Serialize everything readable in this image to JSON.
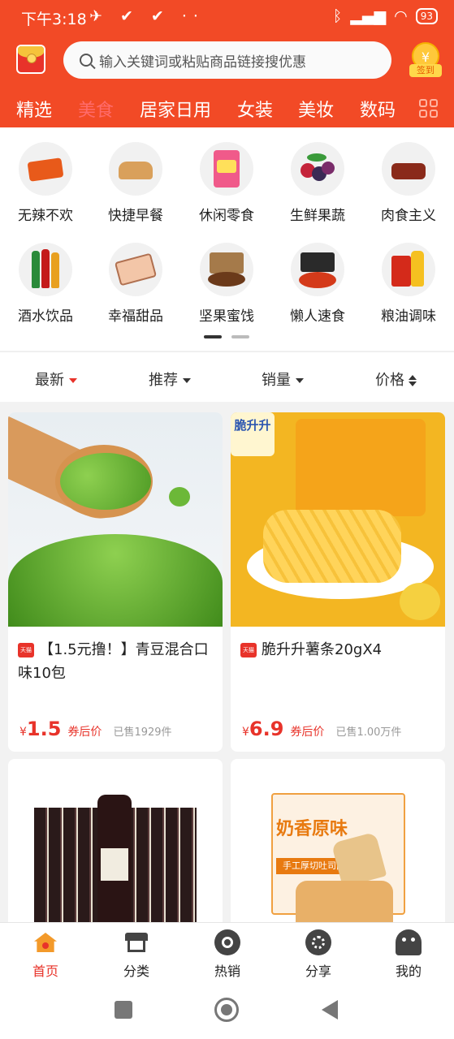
{
  "status_bar": {
    "time": "下午3:18",
    "battery": "93"
  },
  "search": {
    "placeholder": "输入关键词或粘贴商品链接搜优惠"
  },
  "signin": {
    "coin": "¥",
    "label": "签到"
  },
  "categories": [
    "精选",
    "美食",
    "居家日用",
    "女装",
    "美妆",
    "数码"
  ],
  "active_category": "美食",
  "subcategories": [
    "无辣不欢",
    "快捷早餐",
    "休闲零食",
    "生鲜果蔬",
    "肉食主义",
    "酒水饮品",
    "幸福甜品",
    "坚果蜜饯",
    "懒人速食",
    "粮油调味"
  ],
  "sort": {
    "latest": "最新",
    "recommend": "推荐",
    "sales": "销量",
    "price": "价格"
  },
  "products": [
    {
      "title": "【1.5元撸！】青豆混合口味10包",
      "currency": "¥",
      "price": "1.5",
      "after": "券后价",
      "sold": "已售1929件",
      "badge": "天猫"
    },
    {
      "title": "脆升升薯条20gX4",
      "currency": "¥",
      "price": "6.9",
      "after": "券后价",
      "sold": "已售1.00万件",
      "badge": "天猫",
      "package_text": "脆升升"
    },
    {
      "title": "",
      "price": "",
      "sold": ""
    },
    {
      "title": "",
      "price": "",
      "sold": "",
      "package_text": "奶香原味",
      "package_sub": "手工厚切吐司面包"
    }
  ],
  "tabbar": [
    "首页",
    "分类",
    "热销",
    "分享",
    "我的"
  ],
  "colors": {
    "brand": "#f24a26",
    "price": "#e8332a"
  }
}
